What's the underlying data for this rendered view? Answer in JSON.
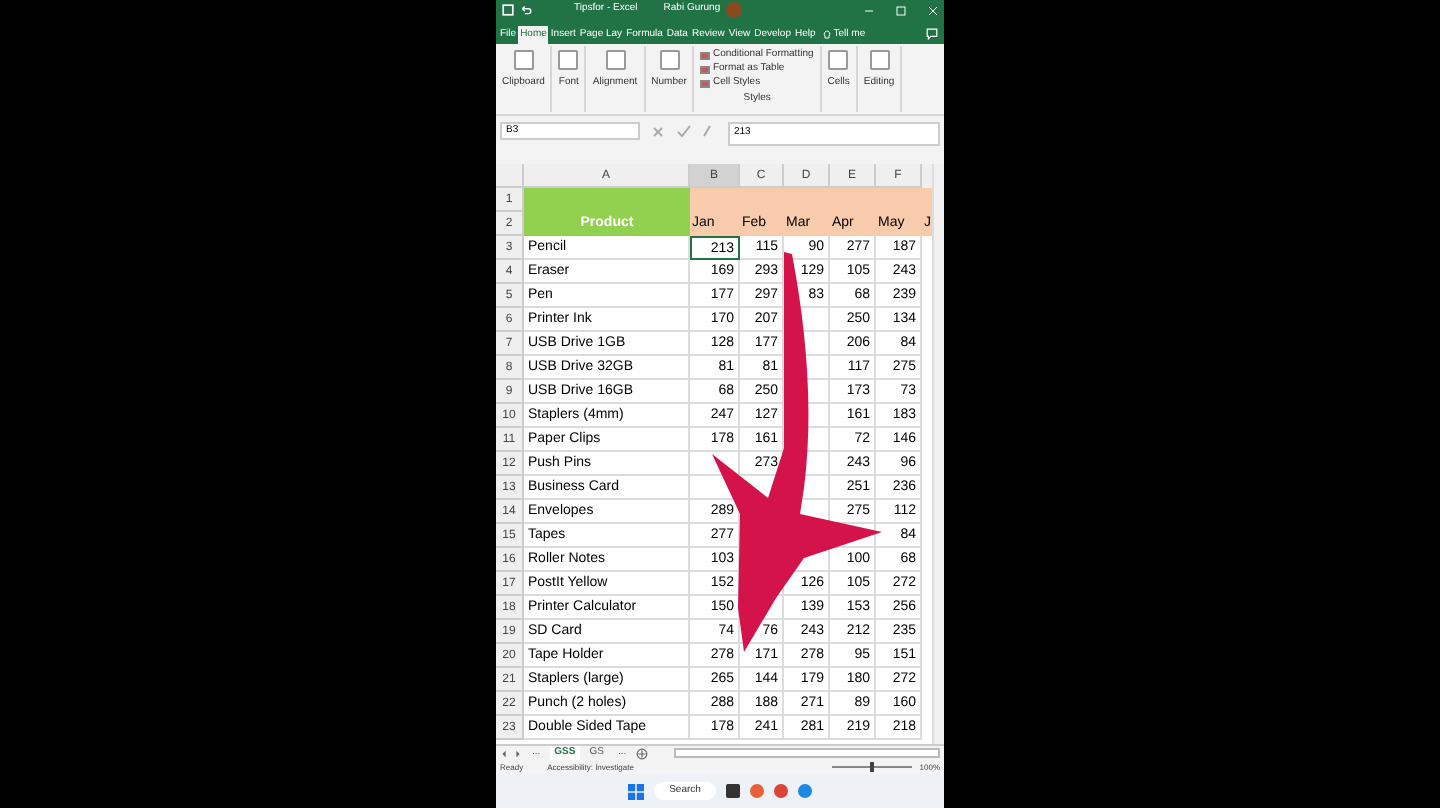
{
  "window": {
    "title": "Tipsfor - Excel",
    "user": "Rabi Gurung"
  },
  "ribbon_tabs": [
    {
      "label": "File",
      "selected": false
    },
    {
      "label": "Home",
      "selected": true
    },
    {
      "label": "Insert",
      "selected": false
    },
    {
      "label": "Page Lay",
      "selected": false
    },
    {
      "label": "Formula",
      "selected": false
    },
    {
      "label": "Data",
      "selected": false
    },
    {
      "label": "Review",
      "selected": false
    },
    {
      "label": "View",
      "selected": false
    },
    {
      "label": "Develop",
      "selected": false
    },
    {
      "label": "Help",
      "selected": false
    }
  ],
  "tell_me": "Tell me",
  "ribbon_groups": [
    {
      "kind": "button",
      "label": "Clipboard"
    },
    {
      "kind": "button",
      "label": "Font"
    },
    {
      "kind": "button",
      "label": "Alignment"
    },
    {
      "kind": "button",
      "label": "Number"
    },
    {
      "kind": "styles",
      "label": "Styles",
      "items": [
        "Conditional Formatting",
        "Format as Table",
        "Cell Styles"
      ]
    },
    {
      "kind": "button",
      "label": "Cells"
    },
    {
      "kind": "button",
      "label": "Editing"
    }
  ],
  "name_box": "B3",
  "formula": "213",
  "columns": [
    "A",
    "B",
    "C",
    "D",
    "E",
    "F"
  ],
  "header": {
    "row_numbers": [
      "1",
      "2"
    ],
    "product": "Product",
    "months": [
      "Jan",
      "Feb",
      "Mar",
      "Apr",
      "May",
      "J"
    ]
  },
  "rows": [
    {
      "num": "3",
      "product": "Pencil",
      "cells": [
        {
          "text": "213",
          "selected": true
        },
        {
          "text": "115",
          "selected": false
        },
        {
          "text": "90",
          "selected": false
        },
        {
          "text": "277",
          "selected": false
        },
        {
          "text": "187",
          "selected": false
        }
      ]
    },
    {
      "num": "4",
      "product": "Eraser",
      "cells": [
        {
          "text": "169",
          "selected": false
        },
        {
          "text": "293",
          "selected": false
        },
        {
          "text": "129",
          "selected": false
        },
        {
          "text": "105",
          "selected": false
        },
        {
          "text": "243",
          "selected": false
        }
      ]
    },
    {
      "num": "5",
      "product": "Pen",
      "cells": [
        {
          "text": "177",
          "selected": false
        },
        {
          "text": "297",
          "selected": false
        },
        {
          "text": "83",
          "selected": false
        },
        {
          "text": "68",
          "selected": false
        },
        {
          "text": "239",
          "selected": false
        }
      ]
    },
    {
      "num": "6",
      "product": "Printer Ink",
      "cells": [
        {
          "text": "170",
          "selected": false
        },
        {
          "text": "207",
          "selected": false
        },
        {
          "selected": false
        },
        {
          "text": "250",
          "selected": false
        },
        {
          "text": "134",
          "selected": false
        }
      ]
    },
    {
      "num": "7",
      "product": "USB Drive 1GB",
      "cells": [
        {
          "text": "128",
          "selected": false
        },
        {
          "text": "177",
          "selected": false
        },
        {
          "selected": false
        },
        {
          "text": "206",
          "selected": false
        },
        {
          "text": "84",
          "selected": false
        }
      ]
    },
    {
      "num": "8",
      "product": "USB Drive 32GB",
      "cells": [
        {
          "text": "81",
          "selected": false
        },
        {
          "text": "81",
          "selected": false
        },
        {
          "selected": false
        },
        {
          "text": "117",
          "selected": false
        },
        {
          "text": "275",
          "selected": false
        }
      ]
    },
    {
      "num": "9",
      "product": "USB Drive 16GB",
      "cells": [
        {
          "text": "68",
          "selected": false
        },
        {
          "text": "250",
          "selected": false
        },
        {
          "selected": false
        },
        {
          "text": "173",
          "selected": false
        },
        {
          "text": "73",
          "selected": false
        }
      ]
    },
    {
      "num": "10",
      "product": "Staplers (4mm)",
      "cells": [
        {
          "text": "247",
          "selected": false
        },
        {
          "text": "127",
          "selected": false
        },
        {
          "selected": false
        },
        {
          "text": "161",
          "selected": false
        },
        {
          "text": "183",
          "selected": false
        }
      ]
    },
    {
      "num": "11",
      "product": "Paper Clips",
      "cells": [
        {
          "text": "178",
          "selected": false
        },
        {
          "text": "161",
          "selected": false
        },
        {
          "selected": false
        },
        {
          "text": "72",
          "selected": false
        },
        {
          "text": "146",
          "selected": false
        }
      ]
    },
    {
      "num": "12",
      "product": "Push Pins",
      "cells": [
        {},
        {
          "text": "273",
          "selected": false
        },
        {},
        {
          "text": "243",
          "selected": false
        },
        {
          "text": "96",
          "selected": false
        }
      ]
    },
    {
      "num": "13",
      "product": "Business Card",
      "cells": [
        {},
        {},
        {},
        {
          "text": "251",
          "selected": false
        },
        {
          "text": "236",
          "selected": false
        }
      ]
    },
    {
      "num": "14",
      "product": "Envelopes",
      "cells": [
        {
          "text": "289",
          "selected": false
        },
        {},
        {},
        {
          "text": "275",
          "selected": false
        },
        {
          "text": "112",
          "selected": false
        }
      ]
    },
    {
      "num": "15",
      "product": "Tapes",
      "cells": [
        {
          "text": "277",
          "selected": false
        },
        {},
        {},
        {},
        {
          "text": "84",
          "selected": false
        }
      ]
    },
    {
      "num": "16",
      "product": "Roller Notes",
      "cells": [
        {
          "text": "103",
          "selected": false
        },
        {},
        {},
        {
          "text": "100",
          "selected": false
        },
        {
          "text": "68",
          "selected": false
        }
      ]
    },
    {
      "num": "17",
      "product": "PostIt Yellow",
      "cells": [
        {
          "text": "152",
          "selected": false
        },
        {},
        {
          "text": "126",
          "selected": false
        },
        {
          "text": "105",
          "selected": false
        },
        {
          "text": "272",
          "selected": false
        }
      ]
    },
    {
      "num": "18",
      "product": "Printer Calculator",
      "cells": [
        {
          "text": "150",
          "selected": false
        },
        {},
        {
          "text": "139",
          "selected": false
        },
        {
          "text": "153",
          "selected": false
        },
        {
          "text": "256",
          "selected": false
        }
      ]
    },
    {
      "num": "19",
      "product": "SD Card",
      "cells": [
        {
          "text": "74",
          "selected": false
        },
        {
          "text": "76",
          "selected": false
        },
        {
          "text": "243",
          "selected": false
        },
        {
          "text": "212",
          "selected": false
        },
        {
          "text": "235",
          "selected": false
        }
      ]
    },
    {
      "num": "20",
      "product": "Tape Holder",
      "cells": [
        {
          "text": "278",
          "selected": false
        },
        {
          "text": "171",
          "selected": false
        },
        {
          "text": "278",
          "selected": false
        },
        {
          "text": "95",
          "selected": false
        },
        {
          "text": "151",
          "selected": false
        }
      ]
    },
    {
      "num": "21",
      "product": "Staplers (large)",
      "cells": [
        {
          "text": "265",
          "selected": false
        },
        {
          "text": "144",
          "selected": false
        },
        {
          "text": "179",
          "selected": false
        },
        {
          "text": "180",
          "selected": false
        },
        {
          "text": "272",
          "selected": false
        }
      ]
    },
    {
      "num": "22",
      "product": "Punch (2 holes)",
      "cells": [
        {
          "text": "288",
          "selected": false
        },
        {
          "text": "188",
          "selected": false
        },
        {
          "text": "271",
          "selected": false
        },
        {
          "text": "89",
          "selected": false
        },
        {
          "text": "160",
          "selected": false
        }
      ]
    },
    {
      "num": "23",
      "product": "Double Sided Tape",
      "cells": [
        {
          "text": "178",
          "selected": false
        },
        {
          "text": "241",
          "selected": false
        },
        {
          "text": "281",
          "selected": false
        },
        {
          "text": "219",
          "selected": false
        },
        {
          "text": "218",
          "selected": false
        }
      ]
    }
  ],
  "sheet_tabs": [
    {
      "label": "...",
      "selected": false
    },
    {
      "label": "GSS",
      "selected": true
    },
    {
      "label": "GS",
      "selected": false
    },
    {
      "label": "...",
      "selected": false
    }
  ],
  "status_bar": {
    "ready": "Ready",
    "accessibility": "Accessibility: Investigate",
    "zoom": "100%",
    "level": 0.5
  },
  "taskbar": {
    "search": "Search"
  }
}
